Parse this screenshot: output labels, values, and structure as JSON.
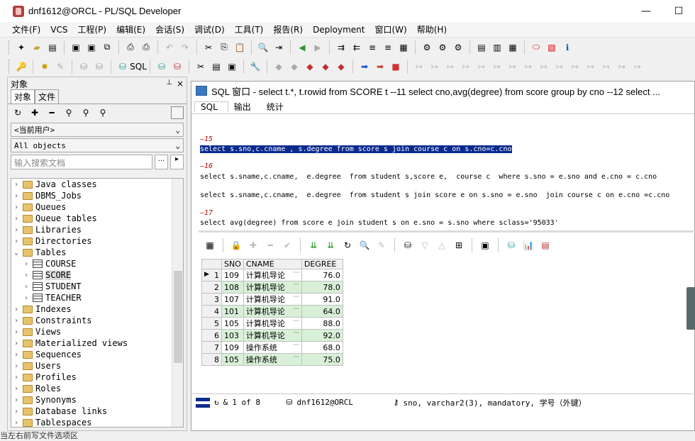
{
  "window": {
    "title": "dnf1612@ORCL - PL/SQL Developer",
    "minimize": "—",
    "maximize": "☐"
  },
  "menu": [
    "文件(F)",
    "VCS",
    "工程(P)",
    "编辑(E)",
    "会话(S)",
    "调试(D)",
    "工具(T)",
    "报告(R)",
    "Deployment",
    "窗口(W)",
    "帮助(H)"
  ],
  "left_panel": {
    "header": "对象",
    "pin": "📌",
    "close": "×",
    "tabs": [
      "对象",
      "文件"
    ],
    "user_combo": "<当前用户>",
    "filter_combo": "All objects",
    "search_placeholder": "输入搜索文档",
    "search_button": "...",
    "tree": [
      {
        "label": "Java classes",
        "type": "folder",
        "expanded": false
      },
      {
        "label": "DBMS_Jobs",
        "type": "folder",
        "expanded": false
      },
      {
        "label": "Queues",
        "type": "folder",
        "expanded": false
      },
      {
        "label": "Queue tables",
        "type": "folder",
        "expanded": false
      },
      {
        "label": "Libraries",
        "type": "folder",
        "expanded": false
      },
      {
        "label": "Directories",
        "type": "folder",
        "expanded": false
      },
      {
        "label": "Tables",
        "type": "folder",
        "expanded": true
      },
      {
        "label": "COURSE",
        "type": "table",
        "child": true
      },
      {
        "label": "SCORE",
        "type": "table",
        "child": true,
        "selected": true
      },
      {
        "label": "STUDENT",
        "type": "table",
        "child": true
      },
      {
        "label": "TEACHER",
        "type": "table",
        "child": true
      },
      {
        "label": "Indexes",
        "type": "folder",
        "expanded": false
      },
      {
        "label": "Constraints",
        "type": "folder",
        "expanded": false
      },
      {
        "label": "Views",
        "type": "folder",
        "expanded": false
      },
      {
        "label": "Materialized views",
        "type": "folder",
        "expanded": false
      },
      {
        "label": "Sequences",
        "type": "folder",
        "expanded": false
      },
      {
        "label": "Users",
        "type": "folder",
        "expanded": false
      },
      {
        "label": "Profiles",
        "type": "folder",
        "expanded": false
      },
      {
        "label": "Roles",
        "type": "folder",
        "expanded": false
      },
      {
        "label": "Synonyms",
        "type": "folder",
        "expanded": false
      },
      {
        "label": "Database links",
        "type": "folder",
        "expanded": false
      },
      {
        "label": "Tablespaces",
        "type": "folder",
        "expanded": false
      }
    ]
  },
  "sql_window": {
    "title": "SQL 窗口 - select t.*, t.rowid from SCORE t --11 select cno,avg(degree) from score group by cno --12 select ...",
    "tabs": [
      "SQL",
      "输出",
      "统计"
    ]
  },
  "editor": {
    "c15": "—15",
    "line15": "select s.sno,c.cname , s.degree from score s join course c on s.cno=c.cno",
    "c16": "—16",
    "line16a": "select s.sname,c.cname,  e.degree  from student s,score e,  course c  where s.sno = e.sno and e.cno = c.cno",
    "line16b": "select s.sname,c.cname,  e.degree  from student s join score e on s.sno = e.sno  join course c on e.cno =c.cno",
    "c17": "—17",
    "line17": "select avg(degree) from score e join student s on e.sno = s.sno where sclass='95033'"
  },
  "result": {
    "columns": [
      "",
      "SNO",
      "CNAME",
      "DEGREE"
    ],
    "rows": [
      [
        "1",
        "109",
        "计算机导论",
        "76.0"
      ],
      [
        "2",
        "108",
        "计算机导论",
        "78.0"
      ],
      [
        "3",
        "107",
        "计算机导论",
        "91.0"
      ],
      [
        "4",
        "101",
        "计算机导论",
        "64.0"
      ],
      [
        "5",
        "105",
        "计算机导论",
        "88.0"
      ],
      [
        "6",
        "103",
        "计算机导论",
        "92.0"
      ],
      [
        "7",
        "109",
        "操作系统",
        "68.0"
      ],
      [
        "8",
        "105",
        "操作系统",
        "75.0"
      ]
    ],
    "cell_more": "···"
  },
  "status": {
    "amp": "&",
    "record": "1 of 8",
    "connection": "dnf1612@ORCL",
    "column_info": "sno, varchar2(3), mandatory, 学号（外键）"
  },
  "bottom_text": "当左右前写文件选项区"
}
